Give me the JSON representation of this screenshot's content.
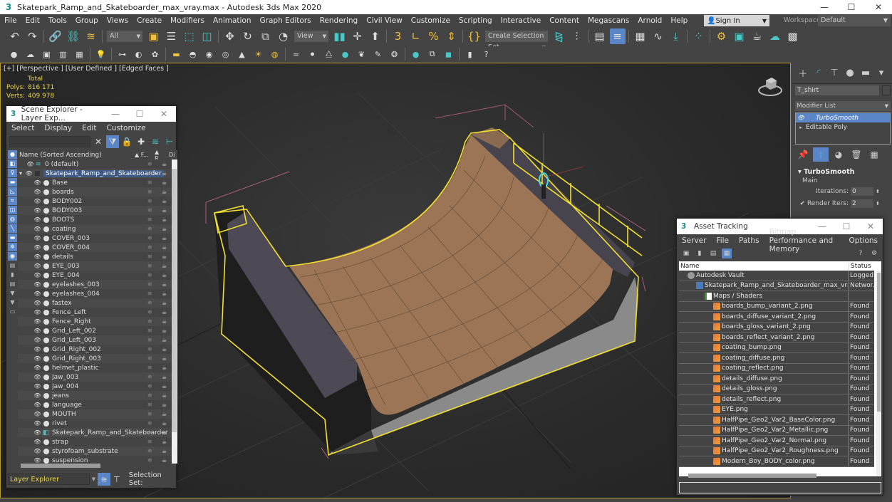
{
  "titlebar": {
    "app_icon": "3ds-max-icon",
    "title": "Skatepark_Ramp_and_Skateboarder_max_vray.max - Autodesk 3ds Max 2020",
    "minimize": "—",
    "maximize": "☐",
    "close": "✕"
  },
  "menubar": {
    "items": [
      "File",
      "Edit",
      "Tools",
      "Group",
      "Views",
      "Create",
      "Modifiers",
      "Animation",
      "Graph Editors",
      "Rendering",
      "Civil View",
      "Customize",
      "Scripting",
      "Interactive",
      "Content",
      "Megascans",
      "Arnold",
      "Help"
    ],
    "sign_in": "Sign In",
    "workspaces_label": "Workspaces:",
    "workspace_value": "Default"
  },
  "toolbar1": {
    "selection_filter": "All",
    "ref_coord": "View",
    "named_selection": "Create Selection Set"
  },
  "viewport": {
    "label": "[+] [Perspective ] [User Defined ] [Edged Faces ]",
    "stats": {
      "header": "Total",
      "polys_label": "Polys:",
      "polys_value": "816 171",
      "verts_label": "Verts:",
      "verts_value": "409 978"
    },
    "selection_color": "#f2e030"
  },
  "scene_explorer": {
    "title": "Scene Explorer - Layer Exp...",
    "menu": [
      "Select",
      "Display",
      "Edit",
      "Customize"
    ],
    "header_name": "Name (Sorted Ascending)",
    "header_frozen": "▲ F...",
    "header_render": "▲ R...",
    "header_display": "Di",
    "rows": [
      {
        "name": "0 (default)",
        "type": "layer",
        "level": 1
      },
      {
        "name": "Skatepark_Ramp_and_Skateboarder",
        "type": "layer-selected",
        "level": 0
      },
      {
        "name": "Base",
        "type": "object",
        "level": 2
      },
      {
        "name": "boards",
        "type": "object",
        "level": 2
      },
      {
        "name": "BODY002",
        "type": "object",
        "level": 2
      },
      {
        "name": "BODY003",
        "type": "object",
        "level": 2
      },
      {
        "name": "BOOTS",
        "type": "object",
        "level": 2
      },
      {
        "name": "coating",
        "type": "object",
        "level": 2
      },
      {
        "name": "COVER_003",
        "type": "object",
        "level": 2
      },
      {
        "name": "COVER_004",
        "type": "object",
        "level": 2
      },
      {
        "name": "details",
        "type": "object",
        "level": 2
      },
      {
        "name": "EYE_003",
        "type": "object",
        "level": 2
      },
      {
        "name": "EYE_004",
        "type": "object",
        "level": 2
      },
      {
        "name": "eyelashes_003",
        "type": "object",
        "level": 2
      },
      {
        "name": "eyelashes_004",
        "type": "object",
        "level": 2
      },
      {
        "name": "fastex",
        "type": "object",
        "level": 2
      },
      {
        "name": "Fence_Left",
        "type": "object",
        "level": 2
      },
      {
        "name": "Fence_Right",
        "type": "object",
        "level": 2
      },
      {
        "name": "Grid_Left_002",
        "type": "object",
        "level": 2
      },
      {
        "name": "Grid_Left_003",
        "type": "object",
        "level": 2
      },
      {
        "name": "Grid_Right_002",
        "type": "object",
        "level": 2
      },
      {
        "name": "Grid_Right_003",
        "type": "object",
        "level": 2
      },
      {
        "name": "helmet_plastic",
        "type": "object",
        "level": 2
      },
      {
        "name": "Jaw_003",
        "type": "object",
        "level": 2
      },
      {
        "name": "Jaw_004",
        "type": "object",
        "level": 2
      },
      {
        "name": "jeans",
        "type": "object",
        "level": 2
      },
      {
        "name": "language",
        "type": "object",
        "level": 2
      },
      {
        "name": "MOUTH",
        "type": "object",
        "level": 2
      },
      {
        "name": "rivet",
        "type": "object",
        "level": 2
      },
      {
        "name": "Skatepark_Ramp_and_Skateboarder",
        "type": "group",
        "level": 2
      },
      {
        "name": "strap",
        "type": "object",
        "level": 2
      },
      {
        "name": "styrofoam_substrate",
        "type": "object",
        "level": 2
      },
      {
        "name": "suspension",
        "type": "object",
        "level": 2
      }
    ],
    "footer_explorer": "Layer Explorer",
    "footer_selection_set": "Selection Set:"
  },
  "command_panel": {
    "object_name": "T_shirt",
    "modifier_list": "Modifier List",
    "stack": [
      {
        "name": "TurboSmooth",
        "active": true
      },
      {
        "name": "Editable Poly",
        "active": false
      }
    ],
    "rollout_title": "TurboSmooth",
    "group_main": "Main",
    "iterations_label": "Iterations:",
    "iterations_value": "0",
    "render_iters_label": "Render Iters:",
    "render_iters_value": "2",
    "render_iters_checked": true
  },
  "asset_tracking": {
    "title": "Asset Tracking",
    "menu": [
      "Server",
      "File",
      "Paths",
      "Bitmap Performance and Memory",
      "Options"
    ],
    "header_name": "Name",
    "header_status": "Status",
    "rows": [
      {
        "name": "Autodesk Vault",
        "status": "Logged",
        "icon": "vault",
        "level": 0
      },
      {
        "name": "Skatepark_Ramp_and_Skateboarder_max_vray.max",
        "status": "Networ.",
        "icon": "max",
        "level": 1
      },
      {
        "name": "Maps / Shaders",
        "status": "",
        "icon": "maps",
        "level": 2
      },
      {
        "name": "boards_bump_variant_2.png",
        "status": "Found",
        "icon": "png",
        "level": 3
      },
      {
        "name": "boards_diffuse_variant_2.png",
        "status": "Found",
        "icon": "png",
        "level": 3
      },
      {
        "name": "boards_gloss_variant_2.png",
        "status": "Found",
        "icon": "png",
        "level": 3
      },
      {
        "name": "boards_reflect_variant_2.png",
        "status": "Found",
        "icon": "png",
        "level": 3
      },
      {
        "name": "coating_bump.png",
        "status": "Found",
        "icon": "png",
        "level": 3
      },
      {
        "name": "coating_diffuse.png",
        "status": "Found",
        "icon": "png",
        "level": 3
      },
      {
        "name": "coating_reflect.png",
        "status": "Found",
        "icon": "png",
        "level": 3
      },
      {
        "name": "details_diffuse.png",
        "status": "Found",
        "icon": "png",
        "level": 3
      },
      {
        "name": "details_gloss.png",
        "status": "Found",
        "icon": "png",
        "level": 3
      },
      {
        "name": "details_reflect.png",
        "status": "Found",
        "icon": "png",
        "level": 3
      },
      {
        "name": "EYE.png",
        "status": "Found",
        "icon": "png",
        "level": 3
      },
      {
        "name": "HalfPipe_Geo2_Var2_BaseColor.png",
        "status": "Found",
        "icon": "png",
        "level": 3
      },
      {
        "name": "HalfPipe_Geo2_Var2_Metallic.png",
        "status": "Found",
        "icon": "png",
        "level": 3
      },
      {
        "name": "HalfPipe_Geo2_Var2_Normal.png",
        "status": "Found",
        "icon": "png",
        "level": 3
      },
      {
        "name": "HalfPipe_Geo2_Var2_Roughness.png",
        "status": "Found",
        "icon": "png",
        "level": 3
      },
      {
        "name": "Modern_Boy_BODY_color.png",
        "status": "Found",
        "icon": "png",
        "level": 3
      }
    ]
  },
  "colors": {
    "accent_blue": "#5a86c8",
    "teal": "#4cc6c6",
    "stats_yellow": "#e8d34a",
    "panel_bg": "#444444"
  }
}
